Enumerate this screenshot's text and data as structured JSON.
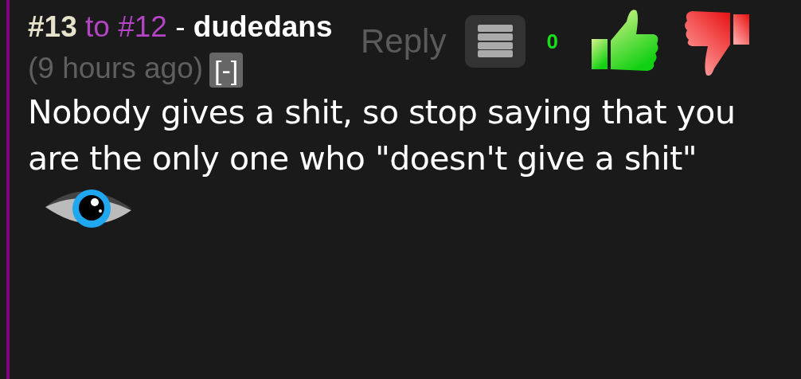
{
  "comment": {
    "number": "#13",
    "reply_to": "to #12",
    "separator": "-",
    "author": "dudedans",
    "time": "(9 hours ago)",
    "collapse": "[-]",
    "actions": {
      "reply": "Reply",
      "score": "0"
    },
    "text": "Nobody gives a shit, so stop saying that you are the only one who \"doesn't give a shit\""
  }
}
